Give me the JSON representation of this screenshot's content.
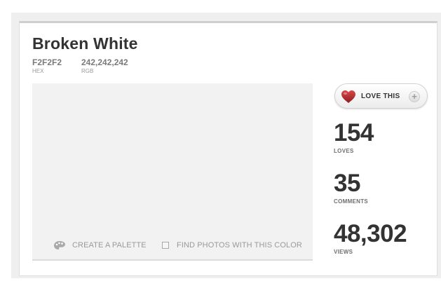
{
  "color": {
    "name": "Broken White",
    "hex": "F2F2F2",
    "hex_label": "HEX",
    "rgb": "242,242,242",
    "rgb_label": "RGB",
    "swatch_color": "#F2F2F2"
  },
  "swatch_actions": {
    "create_palette": "CREATE A PALETTE",
    "create_palette_icon": "palette-icon",
    "find_photos": "FIND PHOTOS WITH THIS COLOR",
    "find_photos_icon": "checkbox-icon"
  },
  "love_button": {
    "label": "LOVE THIS",
    "icon": "heart-icon",
    "add_icon": "plus-icon",
    "heart_color": "#B5252A"
  },
  "stats": {
    "loves": {
      "value": "154",
      "label": "LOVES"
    },
    "comments": {
      "value": "35",
      "label": "COMMENTS"
    },
    "views": {
      "value": "48,302",
      "label": "VIEWS"
    }
  }
}
